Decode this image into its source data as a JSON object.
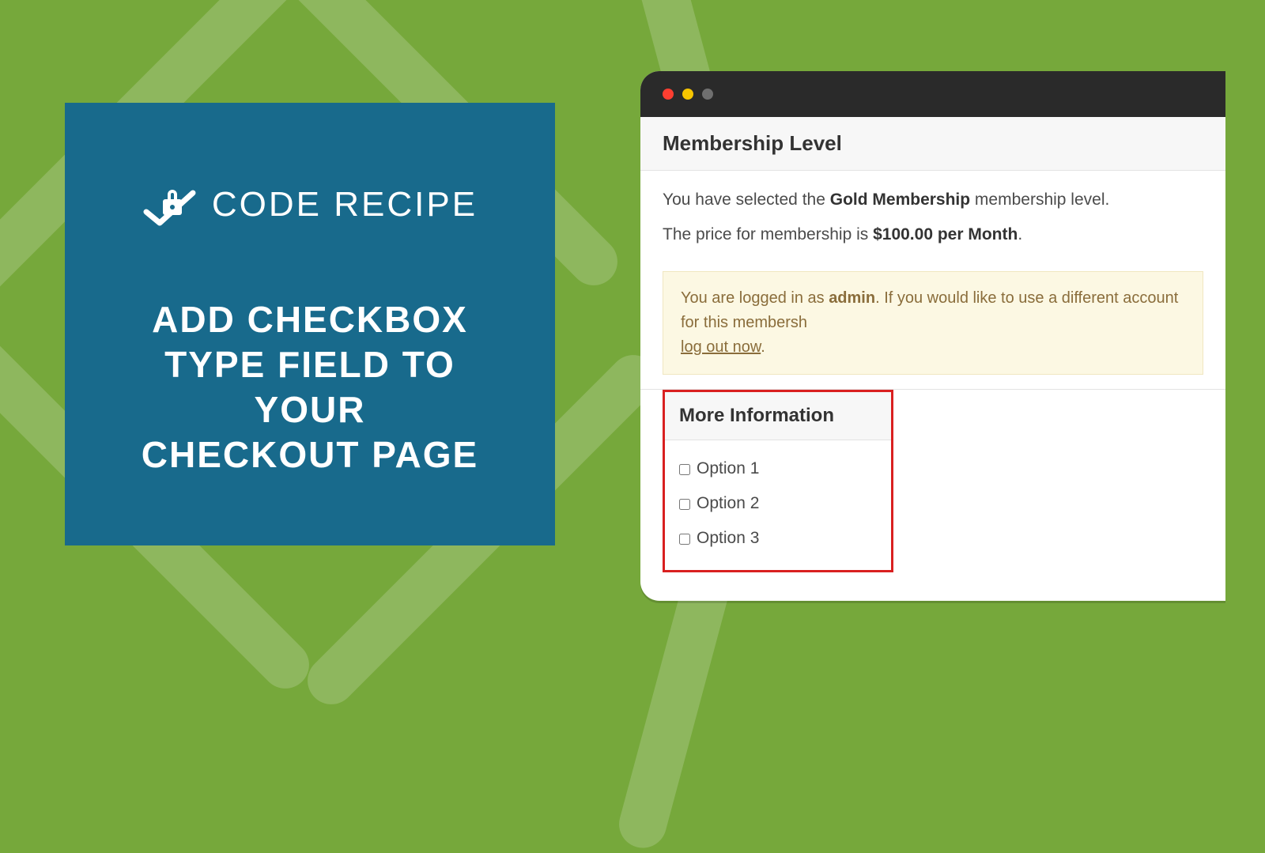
{
  "promo": {
    "logo_text": "CODE RECIPE",
    "title_line1": "ADD CHECKBOX",
    "title_line2": "TYPE FIELD TO YOUR",
    "title_line3": "CHECKOUT PAGE"
  },
  "browser": {
    "membership": {
      "header": "Membership Level",
      "selected_prefix": "You have selected the ",
      "selected_plan": "Gold Membership",
      "selected_suffix": " membership level.",
      "price_prefix": "The price for membership is ",
      "price_value": "$100.00 per Month",
      "price_suffix": "."
    },
    "notice": {
      "prefix": "You are logged in as ",
      "user": "admin",
      "middle": ". If you would like to use a different account for this membersh",
      "link": "log out now",
      "suffix": "."
    },
    "more": {
      "header": "More Information",
      "options": [
        "Option 1",
        "Option 2",
        "Option 3"
      ]
    }
  }
}
